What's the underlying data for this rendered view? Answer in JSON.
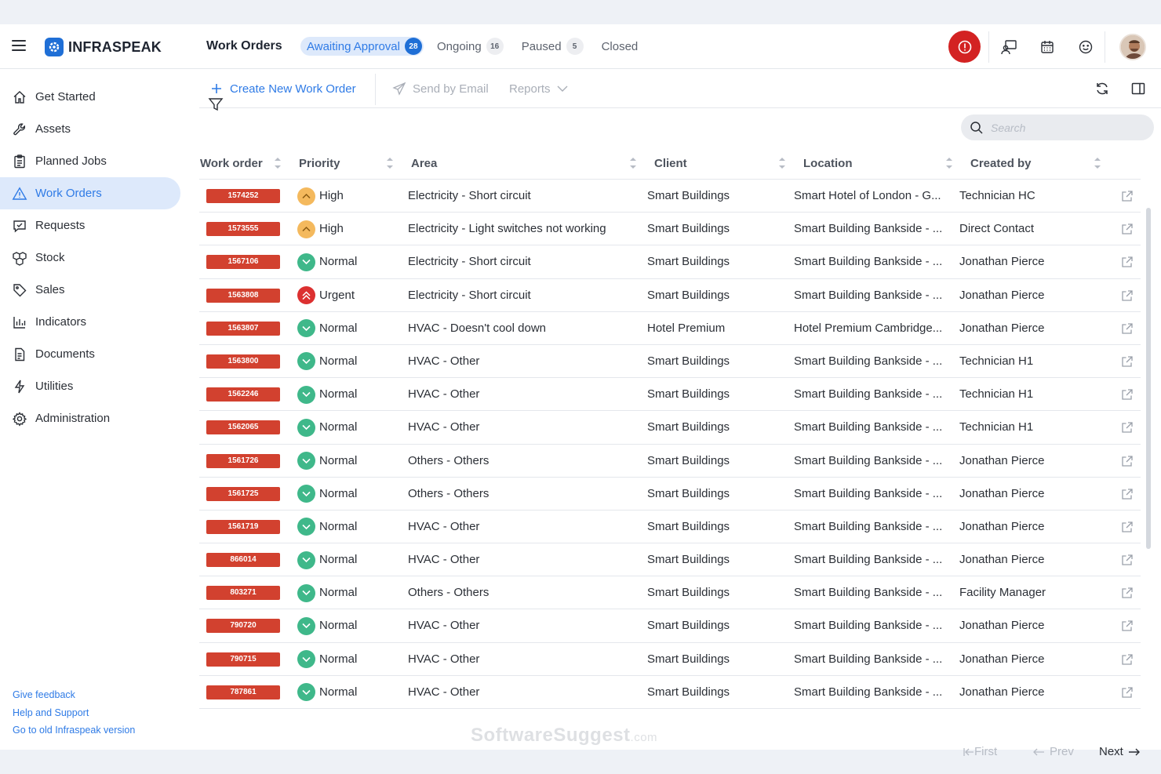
{
  "app": {
    "brand": "INFRASPEAK",
    "page_title": "Work Orders",
    "tabs": [
      {
        "label": "Awaiting Approval",
        "count": "28",
        "active": true
      },
      {
        "label": "Ongoing",
        "count": "16"
      },
      {
        "label": "Paused",
        "count": "5"
      },
      {
        "label": "Closed",
        "count": ""
      }
    ]
  },
  "colors": {
    "accent": "#2f7be6",
    "brand": "#1f6fd6",
    "wo_badge": "#d2412f",
    "priority_normal": "#3fb88a",
    "priority_high": "#f4b95d",
    "priority_urgent": "#dc3030",
    "alert": "#d32222"
  },
  "sidebar": {
    "items": [
      {
        "label": "Get Started",
        "icon": "home-icon"
      },
      {
        "label": "Assets",
        "icon": "wrench-icon"
      },
      {
        "label": "Planned Jobs",
        "icon": "clipboard-icon"
      },
      {
        "label": "Work Orders",
        "icon": "warning-icon",
        "active": true
      },
      {
        "label": "Requests",
        "icon": "message-check-icon"
      },
      {
        "label": "Stock",
        "icon": "boxes-icon"
      },
      {
        "label": "Sales",
        "icon": "tag-icon"
      },
      {
        "label": "Indicators",
        "icon": "bar-chart-icon"
      },
      {
        "label": "Documents",
        "icon": "document-icon"
      },
      {
        "label": "Utilities",
        "icon": "lightning-icon"
      },
      {
        "label": "Administration",
        "icon": "gear-icon"
      }
    ],
    "footer_links": [
      "Give feedback",
      "Help and Support",
      "Go to old Infraspeak version"
    ]
  },
  "toolbar": {
    "create_label": "Create New Work Order",
    "send_label": "Send by Email",
    "reports_label": "Reports"
  },
  "search": {
    "placeholder": "Search"
  },
  "table": {
    "columns": [
      "Work order",
      "Priority",
      "Area",
      "Client",
      "Location",
      "Created by"
    ],
    "rows": [
      {
        "id": "1574252",
        "priority": "High",
        "area": "Electricity - Short circuit",
        "client": "Smart Buildings",
        "location": "Smart Hotel of London - G...",
        "created_by": "Technician HC"
      },
      {
        "id": "1573555",
        "priority": "High",
        "area": "Electricity - Light switches not working",
        "client": "Smart Buildings",
        "location": "Smart Building Bankside - ...",
        "created_by": "Direct Contact"
      },
      {
        "id": "1567106",
        "priority": "Normal",
        "area": "Electricity - Short circuit",
        "client": "Smart Buildings",
        "location": "Smart Building Bankside - ...",
        "created_by": "Jonathan Pierce"
      },
      {
        "id": "1563808",
        "priority": "Urgent",
        "area": "Electricity - Short circuit",
        "client": "Smart Buildings",
        "location": "Smart Building Bankside - ...",
        "created_by": "Jonathan Pierce"
      },
      {
        "id": "1563807",
        "priority": "Normal",
        "area": "HVAC - Doesn't cool down",
        "client": "Hotel Premium",
        "location": "Hotel Premium Cambridge...",
        "created_by": "Jonathan Pierce"
      },
      {
        "id": "1563800",
        "priority": "Normal",
        "area": "HVAC - Other",
        "client": "Smart Buildings",
        "location": "Smart Building Bankside - ...",
        "created_by": "Technician H1"
      },
      {
        "id": "1562246",
        "priority": "Normal",
        "area": "HVAC - Other",
        "client": "Smart Buildings",
        "location": "Smart Building Bankside - ...",
        "created_by": "Technician H1"
      },
      {
        "id": "1562065",
        "priority": "Normal",
        "area": "HVAC - Other",
        "client": "Smart Buildings",
        "location": "Smart Building Bankside - ...",
        "created_by": "Technician H1"
      },
      {
        "id": "1561726",
        "priority": "Normal",
        "area": "Others - Others",
        "client": "Smart Buildings",
        "location": "Smart Building Bankside - ...",
        "created_by": "Jonathan Pierce"
      },
      {
        "id": "1561725",
        "priority": "Normal",
        "area": "Others - Others",
        "client": "Smart Buildings",
        "location": "Smart Building Bankside - ...",
        "created_by": "Jonathan Pierce"
      },
      {
        "id": "1561719",
        "priority": "Normal",
        "area": "HVAC - Other",
        "client": "Smart Buildings",
        "location": "Smart Building Bankside - ...",
        "created_by": "Jonathan Pierce"
      },
      {
        "id": "866014",
        "priority": "Normal",
        "area": "HVAC - Other",
        "client": "Smart Buildings",
        "location": "Smart Building Bankside - ...",
        "created_by": "Jonathan Pierce"
      },
      {
        "id": "803271",
        "priority": "Normal",
        "area": "Others - Others",
        "client": "Smart Buildings",
        "location": "Smart Building Bankside - ...",
        "created_by": "Facility Manager"
      },
      {
        "id": "790720",
        "priority": "Normal",
        "area": "HVAC - Other",
        "client": "Smart Buildings",
        "location": "Smart Building Bankside - ...",
        "created_by": "Jonathan Pierce"
      },
      {
        "id": "790715",
        "priority": "Normal",
        "area": "HVAC - Other",
        "client": "Smart Buildings",
        "location": "Smart Building Bankside - ...",
        "created_by": "Jonathan Pierce"
      },
      {
        "id": "787861",
        "priority": "Normal",
        "area": "HVAC - Other",
        "client": "Smart Buildings",
        "location": "Smart Building Bankside - ...",
        "created_by": "Jonathan Pierce"
      }
    ]
  },
  "pager": {
    "first": "First",
    "prev": "Prev",
    "next": "Next"
  },
  "watermark": {
    "main": "SoftwareSuggest",
    "suffix": ".com"
  }
}
